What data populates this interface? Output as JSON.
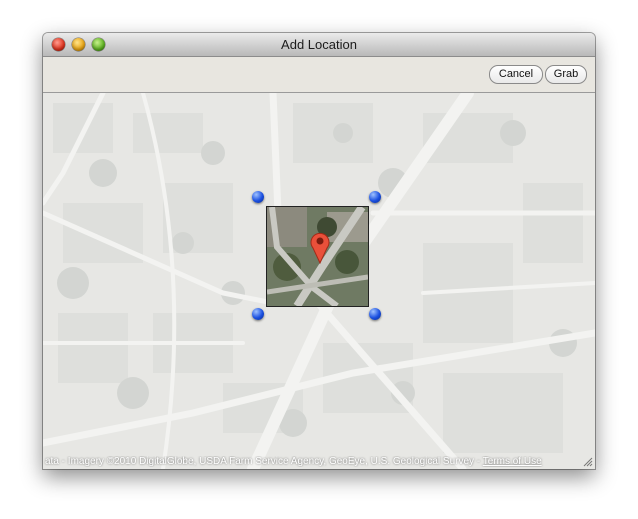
{
  "window": {
    "title": "Add Location"
  },
  "toolbar": {
    "cancel_label": "Cancel",
    "grab_label": "Grab"
  },
  "map": {
    "attribution_text": "ata - Imagery ©2010 DigitalGlobe, USDA Farm Service Agency, GeoEye, U.S. Geological Survey - ",
    "terms_link": "Terms of Use"
  },
  "icons": {
    "close": "close-icon",
    "minimize": "minimize-icon",
    "zoom": "zoom-icon",
    "pin": "map-pin-icon",
    "handle": "resize-handle-icon",
    "grip": "resize-grip-icon"
  },
  "colors": {
    "pin": "#e9503a",
    "handle": "#1a4fe0"
  }
}
